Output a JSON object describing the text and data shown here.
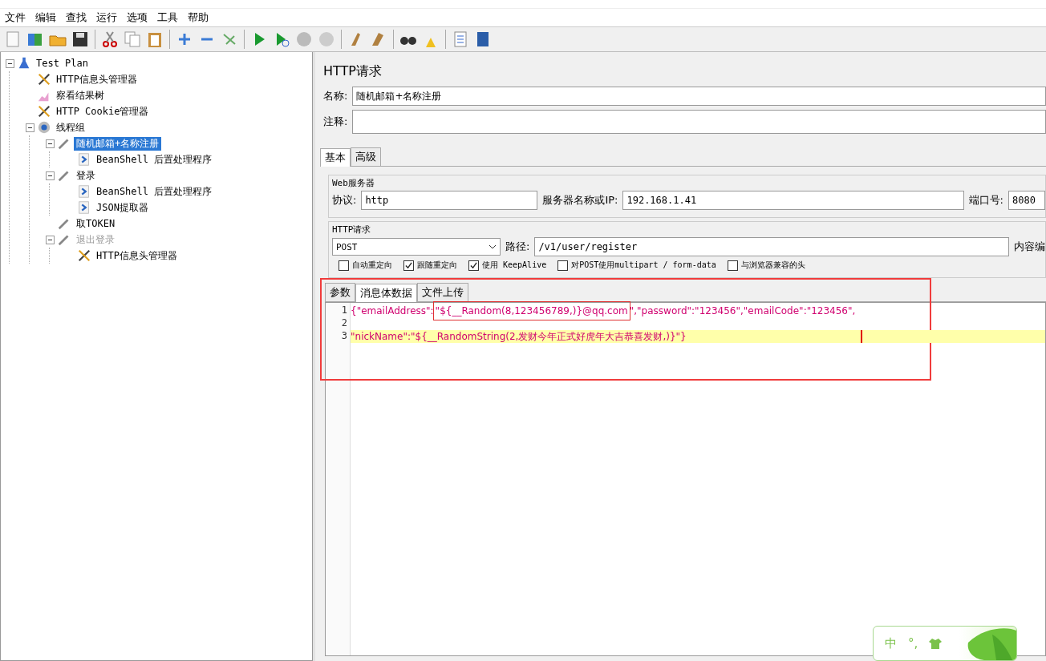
{
  "menu": [
    "文件",
    "编辑",
    "查找",
    "运行",
    "选项",
    "工具",
    "帮助"
  ],
  "tree": [
    {
      "label": "Test Plan",
      "kind": "plan",
      "selected": false,
      "disabled": false,
      "expanded": true,
      "children": [
        {
          "label": "HTTP信息头管理器",
          "kind": "config",
          "selected": false,
          "disabled": false
        },
        {
          "label": "察看结果树",
          "kind": "listener",
          "selected": false,
          "disabled": false
        },
        {
          "label": "HTTP Cookie管理器",
          "kind": "config",
          "selected": false,
          "disabled": false
        },
        {
          "label": "线程组",
          "kind": "threads",
          "selected": false,
          "disabled": false,
          "expanded": true,
          "children": [
            {
              "label": "随机邮箱+名称注册",
              "kind": "sampler",
              "selected": true,
              "disabled": false,
              "expanded": true,
              "children": [
                {
                  "label": "BeanShell 后置处理程序",
                  "kind": "post",
                  "selected": false,
                  "disabled": false
                }
              ]
            },
            {
              "label": "登录",
              "kind": "sampler",
              "selected": false,
              "disabled": false,
              "expanded": true,
              "children": [
                {
                  "label": "BeanShell 后置处理程序",
                  "kind": "post",
                  "selected": false,
                  "disabled": false
                },
                {
                  "label": "JSON提取器",
                  "kind": "post",
                  "selected": false,
                  "disabled": false
                }
              ]
            },
            {
              "label": "取TOKEN",
              "kind": "sampler",
              "selected": false,
              "disabled": false
            },
            {
              "label": "退出登录",
              "kind": "sampler",
              "selected": false,
              "disabled": true,
              "expanded": true,
              "children": [
                {
                  "label": "HTTP信息头管理器",
                  "kind": "config",
                  "selected": false,
                  "disabled": false
                }
              ]
            }
          ]
        }
      ]
    }
  ],
  "panel": {
    "title": "HTTP请求",
    "name_label": "名称:",
    "name_value": "随机邮箱+名称注册",
    "comment_label": "注释:",
    "tabs": [
      {
        "label": "基本",
        "selected": true
      },
      {
        "label": "高级",
        "selected": false
      }
    ],
    "web_server": {
      "legend": "Web服务器",
      "protocol_label": "协议:",
      "protocol": "http",
      "server_label": "服务器名称或IP:",
      "server": "192.168.1.41",
      "port_label": "端口号:",
      "port": "8080"
    },
    "request": {
      "legend": "HTTP请求",
      "method": "POST",
      "path_label": "路径:",
      "path": "/v1/user/register",
      "encoding_label": "内容编",
      "options": [
        {
          "label": "自动重定向",
          "checked": false
        },
        {
          "label": "跟随重定向",
          "checked": true
        },
        {
          "label": "使用 KeepAlive",
          "checked": true
        },
        {
          "label": "对POST使用multipart / form-data",
          "checked": false
        },
        {
          "label": "与浏览器兼容的头",
          "checked": false
        }
      ]
    },
    "body_tabs": [
      {
        "label": "参数",
        "selected": false
      },
      {
        "label": "消息体数据",
        "selected": true
      },
      {
        "label": "文件上传",
        "selected": false
      }
    ],
    "code": [
      {
        "number": "1",
        "current": false,
        "parts": [
          {
            "text": "{\"emailAddress\":",
            "boxed": false
          },
          {
            "text": "\"${__Random(8,123456789,)}@qq.com",
            "boxed": true
          },
          {
            "text": "\",\"password\":\"123456\",\"emailCode\":\"123456\",",
            "boxed": false
          }
        ]
      },
      {
        "number": "2",
        "current": false
      },
      {
        "number": "3",
        "current": true,
        "parts": [
          {
            "text": "\"nickName\":\"${__RandomString(2,发财今年正式好虎年大吉恭喜发财,)}\"}",
            "boxed": false
          }
        ]
      }
    ]
  },
  "ime": {
    "mode": "中",
    "punctuation": "°,"
  }
}
